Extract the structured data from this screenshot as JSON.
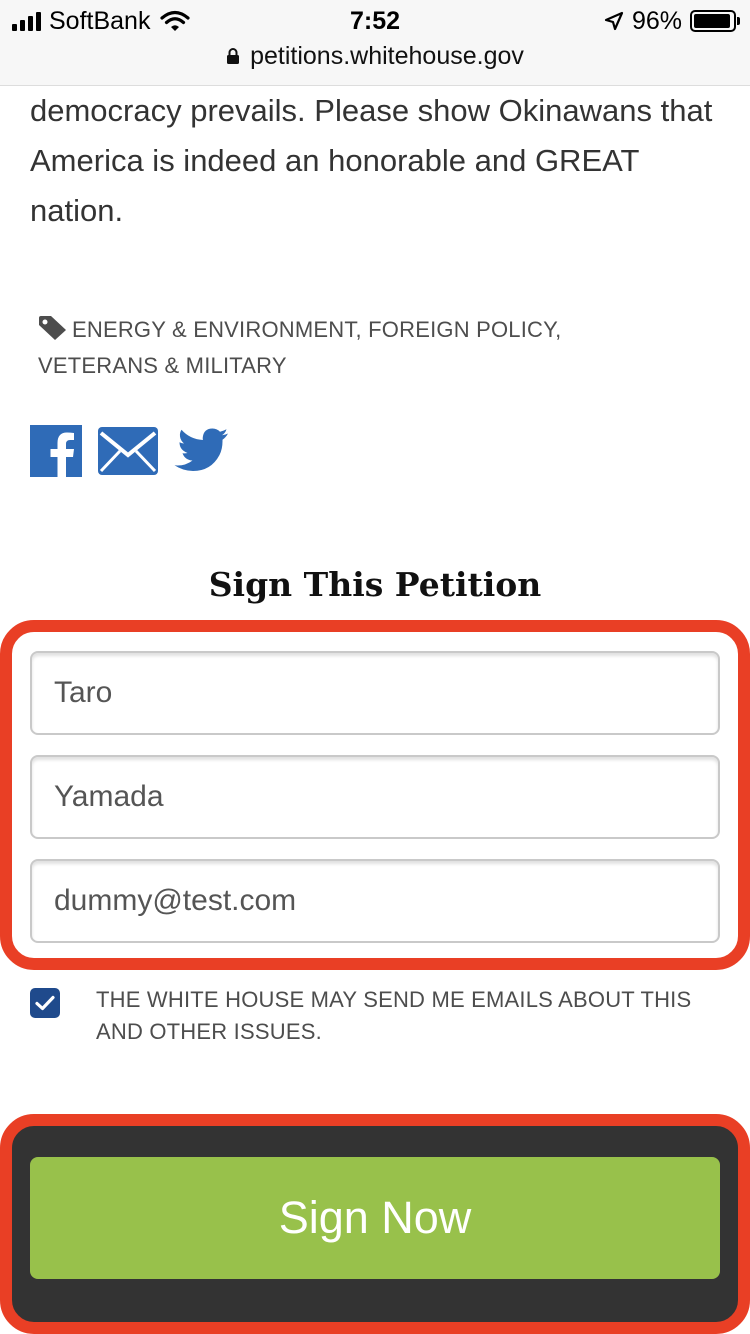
{
  "status_bar": {
    "carrier": "SoftBank",
    "time": "7:52",
    "battery": "96%",
    "battery_level": 0.96
  },
  "browser": {
    "url": "petitions.whitehouse.gov"
  },
  "petition": {
    "body_text": "democracy prevails. Please show Okinawans that America is indeed an honorable and GREAT nation.",
    "tags": [
      "ENERGY & ENVIRONMENT",
      "FOREIGN POLICY",
      "VETERANS & MILITARY"
    ],
    "share_icons": [
      "facebook-icon",
      "email-icon",
      "twitter-icon"
    ]
  },
  "sign_form": {
    "title": "Sign This Petition",
    "first_name": "Taro",
    "last_name": "Yamada",
    "email": "dummy@test.com",
    "email_opt_in_checked": true,
    "email_opt_in_label": "THE WHITE HOUSE MAY SEND ME EMAILS ABOUT THIS AND OTHER ISSUES.",
    "submit_label": "Sign Now"
  },
  "colors": {
    "highlight": "#e93f25",
    "brand_blue": "#2f6bb7",
    "checkbox": "#1f4a8c",
    "button": "#98c14b"
  }
}
